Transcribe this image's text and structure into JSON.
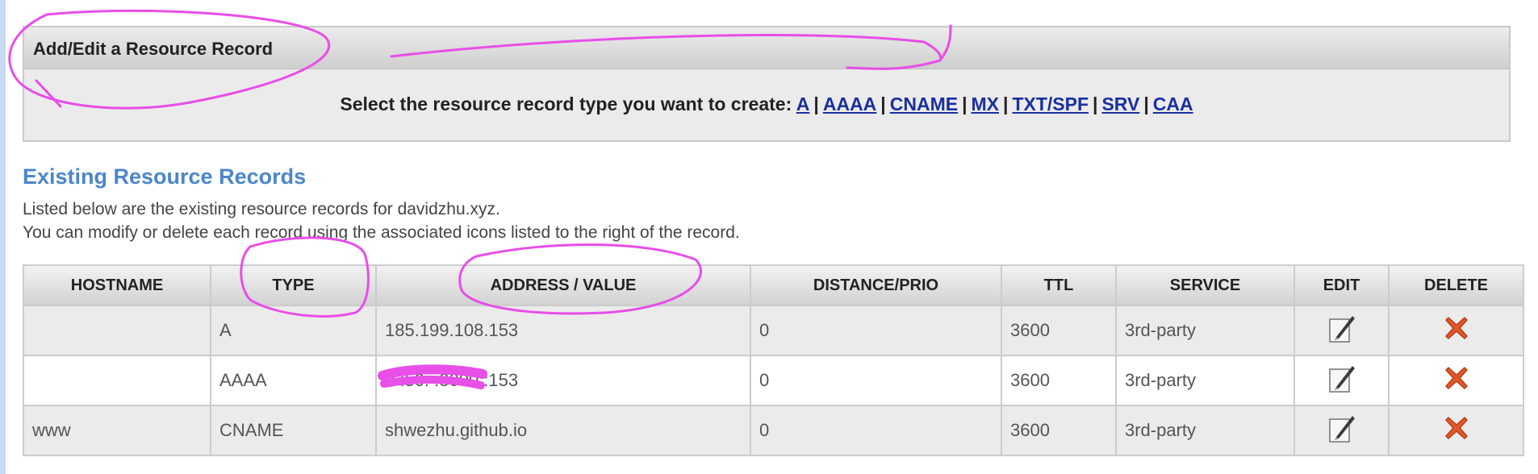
{
  "panel": {
    "title": "Add/Edit a Resource Record",
    "prompt": "Select the resource record type you want to create:",
    "types": [
      "A",
      "AAAA",
      "CNAME",
      "MX",
      "TXT/SPF",
      "SRV",
      "CAA"
    ]
  },
  "section": {
    "title": "Existing Resource Records",
    "line1": "Listed below are the existing resource records for davidzhu.xyz.",
    "line2": "You can modify or delete each record using the associated icons listed to the right of the record."
  },
  "table": {
    "headers": [
      "HOSTNAME",
      "TYPE",
      "ADDRESS / VALUE",
      "DISTANCE/PRIO",
      "TTL",
      "SERVICE",
      "EDIT",
      "DELETE"
    ],
    "rows": [
      {
        "hostname": "",
        "type": "A",
        "value": "185.199.108.153",
        "prio": "0",
        "ttl": "3600",
        "service": "3rd-party"
      },
      {
        "hostname": "",
        "type": "AAAA",
        "value": "2    :50:  :8000::153",
        "prio": "0",
        "ttl": "3600",
        "service": "3rd-party"
      },
      {
        "hostname": "www",
        "type": "CNAME",
        "value": "shwezhu.github.io",
        "prio": "0",
        "ttl": "3600",
        "service": "3rd-party"
      }
    ]
  },
  "icons": {
    "edit": "pencil-edit-icon",
    "delete": "red-x-delete-icon"
  },
  "colors": {
    "link": "#1a2fa0",
    "section_title": "#4c86c9",
    "delete_icon": "#e2572a",
    "annotation": "#e84ee8"
  }
}
